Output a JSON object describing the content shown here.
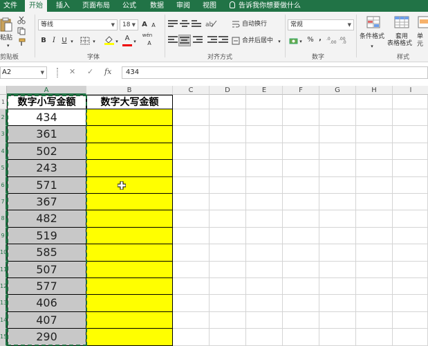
{
  "ribbon_tabs": [
    {
      "label": "文件"
    },
    {
      "label": "开始"
    },
    {
      "label": "插入"
    },
    {
      "label": "页面布局"
    },
    {
      "label": "公式"
    },
    {
      "label": "数据"
    },
    {
      "label": "审阅"
    },
    {
      "label": "视图"
    }
  ],
  "tell_me": "告诉我你想要做什么",
  "clipboard": {
    "paste_label": "粘贴",
    "group_label": "剪贴板"
  },
  "font": {
    "name": "等线",
    "size": "18",
    "bold": "B",
    "italic": "I",
    "underline": "U",
    "grow": "A",
    "shrink": "A",
    "color_a": "A",
    "wen": "wén",
    "group_label": "字体"
  },
  "alignment": {
    "wrap_text": "自动换行",
    "merge_center": "合并后居中",
    "group_label": "对齐方式"
  },
  "number": {
    "format": "常规",
    "percent": "%",
    "comma": ",",
    "group_label": "数字"
  },
  "styles": {
    "conditional": "条件格式",
    "table_format_1": "套用",
    "table_format_2": "表格格式",
    "cell_styles": "单元",
    "group_label": "样式"
  },
  "formula_bar": {
    "name_box": "A2",
    "cancel": "✕",
    "enter": "✓",
    "fx": "fx",
    "value": "434"
  },
  "columns": [
    "A",
    "B",
    "C",
    "D",
    "E",
    "F",
    "G",
    "H",
    "I"
  ],
  "rows": [
    "1",
    "2",
    "3",
    "4",
    "5",
    "6",
    "7",
    "8",
    "9",
    "10",
    "11",
    "12",
    "13",
    "14",
    "15"
  ],
  "sheet": {
    "header_a": "数字小写金额",
    "header_b": "数字大写金额",
    "values": [
      "434",
      "361",
      "502",
      "243",
      "571",
      "367",
      "482",
      "519",
      "585",
      "507",
      "577",
      "406",
      "407",
      "290"
    ]
  },
  "colors": {
    "accent": "#217346",
    "highlight": "#ffff00",
    "selection": "#c8c8c8"
  }
}
